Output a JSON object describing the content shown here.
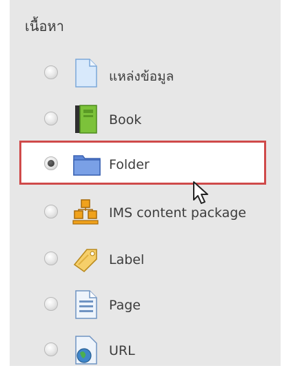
{
  "section": {
    "heading": "เนื้อหา"
  },
  "items": [
    {
      "label": "แหล่งข้อมูล",
      "icon": "file-icon",
      "checked": false
    },
    {
      "label": "Book",
      "icon": "book-icon",
      "checked": false
    },
    {
      "label": "Folder",
      "icon": "folder-icon",
      "checked": true
    },
    {
      "label": "IMS content package",
      "icon": "package-icon",
      "checked": false
    },
    {
      "label": "Label",
      "icon": "tag-icon",
      "checked": false
    },
    {
      "label": "Page",
      "icon": "page-icon",
      "checked": false
    },
    {
      "label": "URL",
      "icon": "globe-icon",
      "checked": false
    }
  ],
  "colors": {
    "panel": "#e7e7e7",
    "highlight_border": "#cf4a4a",
    "text": "#3c3c3c"
  }
}
